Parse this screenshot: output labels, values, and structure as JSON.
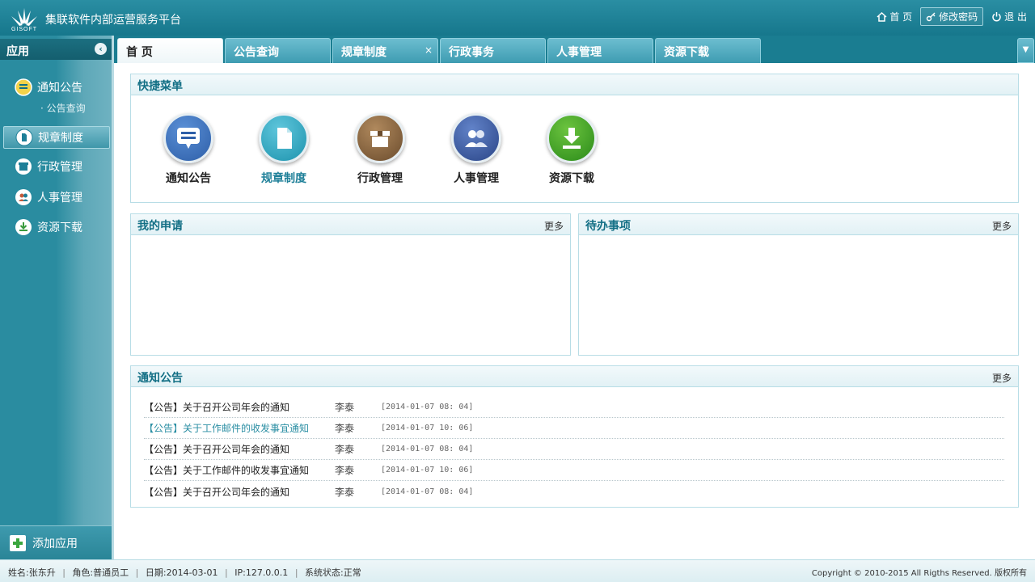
{
  "header": {
    "logo_text": "GISOFT",
    "title": "集联软件内部运营服务平台",
    "links": [
      {
        "label": "首 页",
        "icon": "home-icon"
      },
      {
        "label": "修改密码",
        "icon": "key-icon"
      },
      {
        "label": "退 出",
        "icon": "power-icon"
      }
    ]
  },
  "sidebar": {
    "title": "应用",
    "collapse": "‹",
    "items": [
      {
        "label": "通知公告",
        "icon": "notice-icon",
        "color": "#f3d24a"
      },
      {
        "label": "规章制度",
        "icon": "document-icon",
        "color": "#2c8fa6"
      },
      {
        "label": "行政管理",
        "icon": "box-icon",
        "color": "#8f6d45"
      },
      {
        "label": "人事管理",
        "icon": "people-icon",
        "color": "#3b5ca5"
      },
      {
        "label": "资源下载",
        "icon": "download-icon",
        "color": "#3a9a3e"
      }
    ],
    "sub_item": "· 公告查询",
    "footer": "添加应用"
  },
  "tabs": [
    {
      "label": "首 页",
      "active": true
    },
    {
      "label": "公告查询"
    },
    {
      "label": "规章制度",
      "closable": true,
      "close": "×"
    },
    {
      "label": "行政事务"
    },
    {
      "label": "人事管理"
    },
    {
      "label": "资源下载"
    }
  ],
  "tab_dropdown": "▼",
  "quick_menu": {
    "title": "快捷菜单",
    "items": [
      {
        "label": "通知公告",
        "icon": "notice-icon",
        "color": "#2e5fa8"
      },
      {
        "label": "规章制度",
        "icon": "document-icon",
        "color": "#1d93ad"
      },
      {
        "label": "行政管理",
        "icon": "box-icon",
        "color": "#7a5a38"
      },
      {
        "label": "人事管理",
        "icon": "people-icon",
        "color": "#2f4c8f"
      },
      {
        "label": "资源下载",
        "icon": "download-icon",
        "color": "#2f8f1f"
      }
    ]
  },
  "my_requests": {
    "title": "我的申请",
    "more": "更多"
  },
  "todo": {
    "title": "待办事项",
    "more": "更多"
  },
  "notices": {
    "title": "通知公告",
    "more": "更多",
    "rows": [
      {
        "title": "【公告】关于召开公司年会的通知",
        "author": "李泰",
        "date": "[2014-01-07  08: 04]"
      },
      {
        "title": "【公告】关于工作邮件的收发事宜通知",
        "author": "李泰",
        "date": "[2014-01-07  10: 06]",
        "highlight": true
      },
      {
        "title": "【公告】关于召开公司年会的通知",
        "author": "李泰",
        "date": "[2014-01-07  08: 04]"
      },
      {
        "title": "【公告】关于工作邮件的收发事宜通知",
        "author": "李泰",
        "date": "[2014-01-07  10: 06]"
      },
      {
        "title": "【公告】关于召开公司年会的通知",
        "author": "李泰",
        "date": "[2014-01-07  08: 04]"
      }
    ]
  },
  "status": {
    "name": "姓名:张东升",
    "role": "角色:普通员工",
    "date": "日期:2014-03-01",
    "ip": "IP:127.0.0.1",
    "system": "系统状态:正常",
    "separator": "|",
    "copyright": "Copyright © 2010-2015 All Rigths Reserved. 版权所有"
  }
}
